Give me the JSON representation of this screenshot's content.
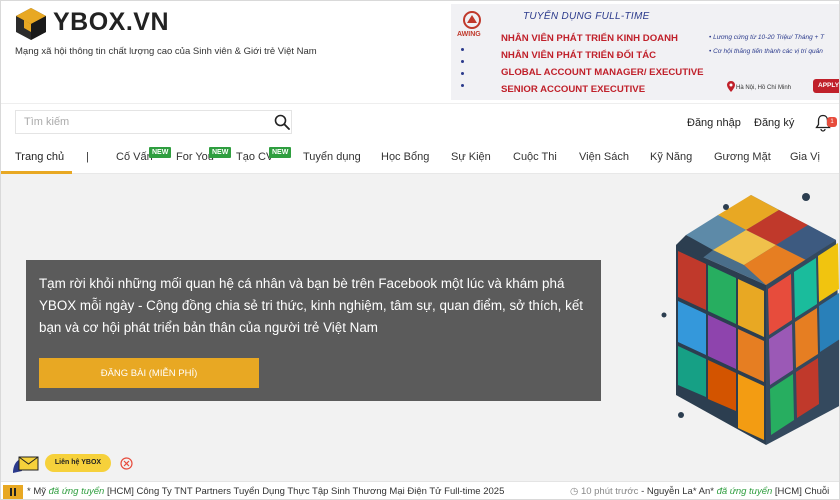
{
  "header": {
    "logo_text": "YBOX.VN",
    "tagline": "Mạng xã hội thông tin chất lượng cao của Sinh viên & Giới trẻ Việt Nam"
  },
  "banner": {
    "brand": "AWING",
    "heading": "TUYỂN DỤNG FULL-TIME",
    "jobs": [
      "NHÂN VIÊN PHÁT TRIỂN KINH DOANH",
      "NHÂN VIÊN PHÁT TRIỂN ĐỐI TÁC",
      "GLOBAL ACCOUNT MANAGER/ EXECUTIVE",
      "SENIOR ACCOUNT EXECUTIVE"
    ],
    "perk_1": "• Lương cứng từ 10-20 Triệu/ Tháng + T",
    "perk_2": "• Cơ hội thăng tiến thành các vị trí quản",
    "location": "Hà Nội, Hồ Chí Minh",
    "apply": "APPLY"
  },
  "search": {
    "placeholder": "Tìm kiếm",
    "value": ""
  },
  "auth": {
    "login": "Đăng nhập",
    "register": "Đăng ký",
    "notification_count": "1"
  },
  "nav": {
    "items": [
      "Trang chủ",
      "Cố Vấn",
      "For You",
      "Tạo CV",
      "Tuyển dụng",
      "Học Bổng",
      "Sự Kiện",
      "Cuộc Thi",
      "Viện Sách",
      "Kỹ Năng",
      "Gương Mặt",
      "Gia Vị"
    ],
    "separator": "|",
    "new_badge": "NEW"
  },
  "hero": {
    "text": "Tạm rời khỏi những mối quan hệ cá nhân và bạn bè trên Facebook một lúc và khám phá YBOX mỗi ngày - Cộng đồng chia sẻ tri thức, kinh nghiệm, tâm sự, quan điểm, sở thích, kết bạn và cơ hội phát triển bản thân của người trẻ Việt Nam",
    "button": "ĐĂNG BÀI (MIỄN PHÍ)"
  },
  "contact": {
    "label": "Liên hệ YBOX"
  },
  "ticker": {
    "seg1_name": "* Mỹ",
    "seg1_action": "đã ứng tuyển",
    "seg1_job": "[HCM] Công Ty TNT Partners Tuyển Dụng Thực Tập Sinh Thương Mại Điện Tử Full-time 2025",
    "seg2_time": "10 phút trước",
    "seg2_name": "- Nguyễn La* An*",
    "seg2_action": "đã ứng tuyển",
    "seg2_job": "[HCM] Chuỗi"
  },
  "colors": {
    "accent": "#e8a823",
    "new_badge": "#2f9e3f",
    "hero_card": "#5b5b5b",
    "banner_red": "#c0202a",
    "banner_blue": "#2b3a8c"
  }
}
